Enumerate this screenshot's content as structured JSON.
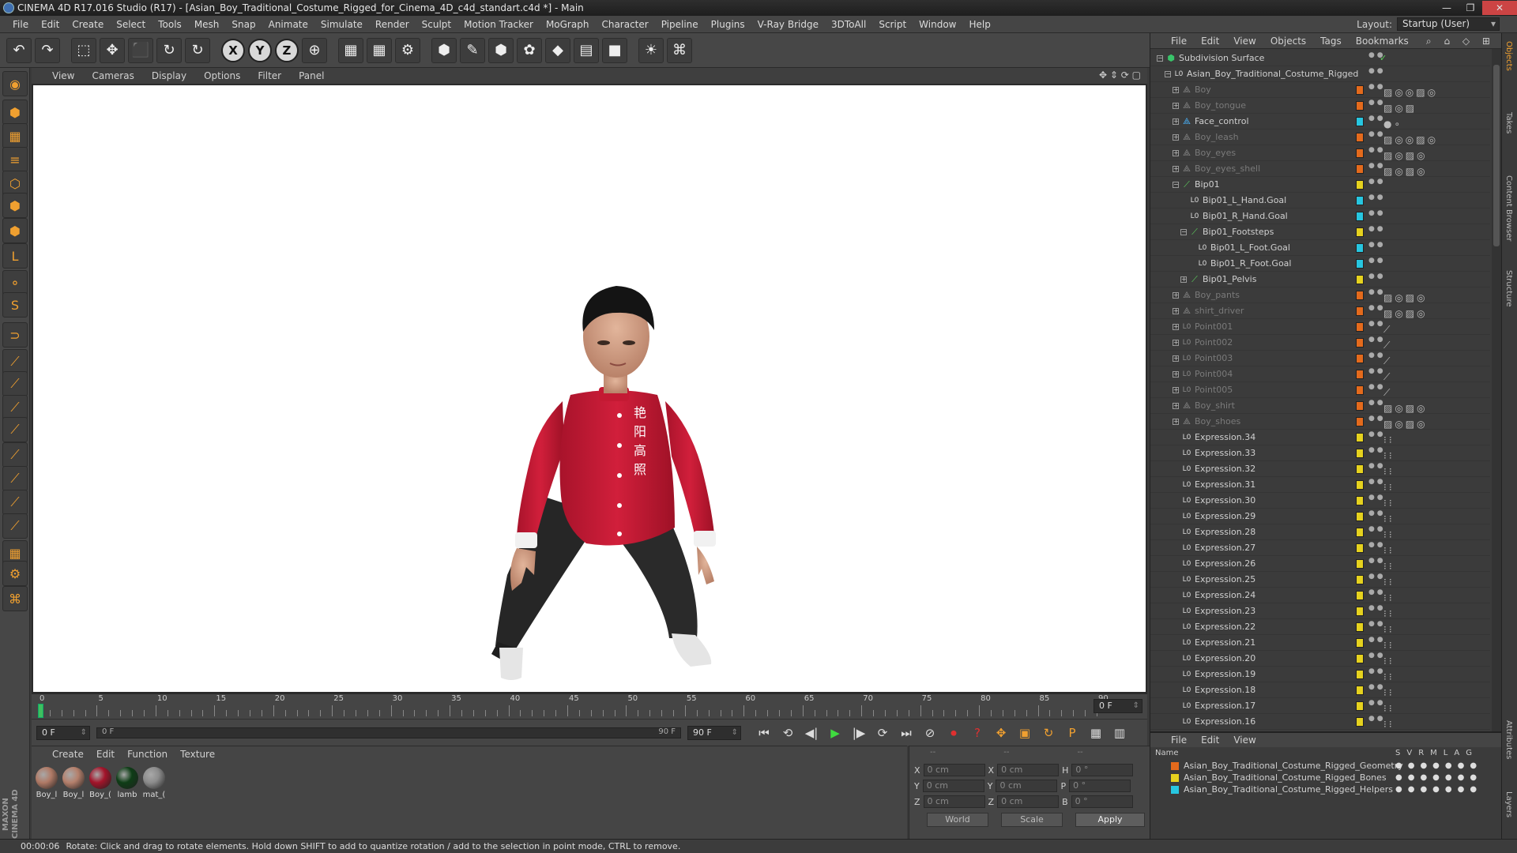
{
  "window": {
    "title": "CINEMA 4D R17.016 Studio (R17) - [Asian_Boy_Traditional_Costume_Rigged_for_Cinema_4D_c4d_standart.c4d *] - Main",
    "min": "—",
    "max": "❐",
    "close": "✕"
  },
  "menu": [
    "File",
    "Edit",
    "Create",
    "Select",
    "Tools",
    "Mesh",
    "Snap",
    "Animate",
    "Simulate",
    "Render",
    "Sculpt",
    "Motion Tracker",
    "MoGraph",
    "Character",
    "Pipeline",
    "Plugins",
    "V-Ray Bridge",
    "3DToAll",
    "Script",
    "Window",
    "Help"
  ],
  "layout": {
    "label": "Layout:",
    "value": "Startup (User)"
  },
  "toolbar": {
    "icons": [
      "undo-icon",
      "redo-icon",
      "live-selection-icon",
      "move-icon",
      "scale-icon",
      "rotate-icon",
      "recent-tool-icon",
      "x-axis-icon",
      "y-axis-icon",
      "z-axis-icon",
      "world-coordinates-icon",
      "render-view-icon",
      "render-picture-viewer-icon",
      "edit-render-settings-icon",
      "cube-icon",
      "pen-spline-icon",
      "subdivision-surface-icon",
      "cloner-icon",
      "deformer-icon",
      "floor-icon",
      "camera-icon",
      "light-icon",
      "python-icon"
    ],
    "glyphs": [
      "↶",
      "↷",
      "⬚",
      "✥",
      "⬛",
      "↻",
      "↻",
      "X",
      "Y",
      "Z",
      "⊕",
      "▦",
      "▦",
      "⚙",
      "⬢",
      "✎",
      "⬢",
      "✿",
      "◆",
      "▤",
      "■",
      "☀",
      "⌘"
    ]
  },
  "viewport": {
    "menu": [
      "View",
      "Cameras",
      "Display",
      "Options",
      "Filter",
      "Panel"
    ],
    "nav": "✥ ⇕ ⟳ ▢"
  },
  "timeline": {
    "ticks": [
      "0",
      "5",
      "10",
      "15",
      "20",
      "25",
      "30",
      "35",
      "40",
      "45",
      "50",
      "55",
      "60",
      "65",
      "70",
      "75",
      "80",
      "85",
      "90"
    ],
    "current_frame": "0 F",
    "start_field": "0 F",
    "range_start": "0 F",
    "range_end": "90 F",
    "end_field": "90 F"
  },
  "transport": {
    "glyphs": [
      "⏮",
      "⟲",
      "◀|",
      "▶",
      "|▶",
      "⟳",
      "⏭",
      "⊘",
      "⏺",
      "?",
      "✥",
      "▣",
      "↻",
      "P",
      "▦",
      "▥"
    ]
  },
  "materials": {
    "menu": [
      "Create",
      "Edit",
      "Function",
      "Texture"
    ],
    "items": [
      {
        "label": "Boy_l",
        "color": "#b07a66"
      },
      {
        "label": "Boy_l",
        "color": "#b5806c"
      },
      {
        "label": "Boy_(",
        "color": "#a3142a"
      },
      {
        "label": "lamb",
        "color": "#0e3d16"
      },
      {
        "label": "mat_(",
        "color": "#8c8c8c"
      }
    ]
  },
  "coords": {
    "headers": [
      "--",
      "--",
      "--"
    ],
    "rows": [
      {
        "a": "X",
        "av": "0 cm",
        "b": "X",
        "bv": "0 cm",
        "c": "H",
        "cv": "0 °"
      },
      {
        "a": "Y",
        "av": "0 cm",
        "b": "Y",
        "bv": "0 cm",
        "c": "P",
        "cv": "0 °"
      },
      {
        "a": "Z",
        "av": "0 cm",
        "b": "Z",
        "bv": "0 cm",
        "c": "B",
        "cv": "0 °"
      }
    ],
    "mode": "World",
    "type": "Scale",
    "apply": "Apply"
  },
  "status": {
    "time": "00:00:06",
    "message": "Rotate: Click and drag to rotate elements. Hold down SHIFT to add to quantize rotation / add to the selection in point mode, CTRL to remove."
  },
  "objects": {
    "menu": [
      "File",
      "Edit",
      "View",
      "Objects",
      "Tags",
      "Bookmarks"
    ],
    "toolicons": "⌕ ⌂ ◇ ⊞",
    "items": [
      {
        "name": "Subdivision Surface",
        "depth": 0,
        "tog": "−",
        "icon": "⬢",
        "iconc": "#39c46a",
        "layer": "",
        "dim": false,
        "check": true
      },
      {
        "name": "Asian_Boy_Traditional_Costume_Rigged",
        "depth": 1,
        "tog": "−",
        "icon": "L0",
        "iconc": "#ddd",
        "layer": "",
        "dim": false
      },
      {
        "name": "Boy",
        "depth": 2,
        "tog": "+",
        "icon": "⟁",
        "iconc": "#888",
        "layer": "#e46a1c",
        "dim": true,
        "tags": "▨◎◎▨◎"
      },
      {
        "name": "Boy_tongue",
        "depth": 2,
        "tog": "+",
        "icon": "⟁",
        "iconc": "#888",
        "layer": "#e46a1c",
        "dim": true,
        "tags": "▨◎▨"
      },
      {
        "name": "Face_control",
        "depth": 2,
        "tog": "+",
        "icon": "⟁",
        "iconc": "#4ab5ff",
        "layer": "#27c6e0",
        "dim": false,
        "tags": "●∘"
      },
      {
        "name": "Boy_leash",
        "depth": 2,
        "tog": "+",
        "icon": "⟁",
        "iconc": "#888",
        "layer": "#e46a1c",
        "dim": true,
        "tags": "▨◎◎▨◎"
      },
      {
        "name": "Boy_eyes",
        "depth": 2,
        "tog": "+",
        "icon": "⟁",
        "iconc": "#888",
        "layer": "#e46a1c",
        "dim": true,
        "tags": "▨◎▨◎"
      },
      {
        "name": "Boy_eyes_shell",
        "depth": 2,
        "tog": "+",
        "icon": "⟁",
        "iconc": "#888",
        "layer": "#e46a1c",
        "dim": true,
        "tags": "▨◎▨◎"
      },
      {
        "name": "Bip01",
        "depth": 2,
        "tog": "−",
        "icon": "⟋",
        "iconc": "#5fd35f",
        "layer": "#e6d21e",
        "dim": false
      },
      {
        "name": "Bip01_L_Hand.Goal",
        "depth": 3,
        "tog": "",
        "icon": "L0",
        "iconc": "#ddd",
        "layer": "#27c6e0",
        "dim": false
      },
      {
        "name": "Bip01_R_Hand.Goal",
        "depth": 3,
        "tog": "",
        "icon": "L0",
        "iconc": "#ddd",
        "layer": "#27c6e0",
        "dim": false
      },
      {
        "name": "Bip01_Footsteps",
        "depth": 3,
        "tog": "−",
        "icon": "⟋",
        "iconc": "#5fd35f",
        "layer": "#e6d21e",
        "dim": false
      },
      {
        "name": "Bip01_L_Foot.Goal",
        "depth": 4,
        "tog": "",
        "icon": "L0",
        "iconc": "#ddd",
        "layer": "#27c6e0",
        "dim": false
      },
      {
        "name": "Bip01_R_Foot.Goal",
        "depth": 4,
        "tog": "",
        "icon": "L0",
        "iconc": "#ddd",
        "layer": "#27c6e0",
        "dim": false
      },
      {
        "name": "Bip01_Pelvis",
        "depth": 3,
        "tog": "+",
        "icon": "⟋",
        "iconc": "#5fd35f",
        "layer": "#e6d21e",
        "dim": false
      },
      {
        "name": "Boy_pants",
        "depth": 2,
        "tog": "+",
        "icon": "⟁",
        "iconc": "#888",
        "layer": "#e46a1c",
        "dim": true,
        "tags": "▨◎▨◎"
      },
      {
        "name": "shirt_driver",
        "depth": 2,
        "tog": "+",
        "icon": "⟁",
        "iconc": "#888",
        "layer": "#e46a1c",
        "dim": true,
        "tags": "▨◎▨◎"
      },
      {
        "name": "Point001",
        "depth": 2,
        "tog": "+",
        "icon": "L0",
        "iconc": "#888",
        "layer": "#e46a1c",
        "dim": true,
        "tags": "⟋"
      },
      {
        "name": "Point002",
        "depth": 2,
        "tog": "+",
        "icon": "L0",
        "iconc": "#888",
        "layer": "#e46a1c",
        "dim": true,
        "tags": "⟋"
      },
      {
        "name": "Point003",
        "depth": 2,
        "tog": "+",
        "icon": "L0",
        "iconc": "#888",
        "layer": "#e46a1c",
        "dim": true,
        "tags": "⟋"
      },
      {
        "name": "Point004",
        "depth": 2,
        "tog": "+",
        "icon": "L0",
        "iconc": "#888",
        "layer": "#e46a1c",
        "dim": true,
        "tags": "⟋"
      },
      {
        "name": "Point005",
        "depth": 2,
        "tog": "+",
        "icon": "L0",
        "iconc": "#888",
        "layer": "#e46a1c",
        "dim": true,
        "tags": "⟋"
      },
      {
        "name": "Boy_shirt",
        "depth": 2,
        "tog": "+",
        "icon": "⟁",
        "iconc": "#888",
        "layer": "#e46a1c",
        "dim": true,
        "tags": "▨◎▨◎"
      },
      {
        "name": "Boy_shoes",
        "depth": 2,
        "tog": "+",
        "icon": "⟁",
        "iconc": "#888",
        "layer": "#e46a1c",
        "dim": true,
        "tags": "▨◎▨◎"
      },
      {
        "name": "Expression.34",
        "depth": 2,
        "tog": "",
        "icon": "L0",
        "iconc": "#ddd",
        "layer": "#e6d21e",
        "dim": false,
        "tags": "⁝⁝"
      },
      {
        "name": "Expression.33",
        "depth": 2,
        "tog": "",
        "icon": "L0",
        "iconc": "#ddd",
        "layer": "#e6d21e",
        "dim": false,
        "tags": "⁝⁝"
      },
      {
        "name": "Expression.32",
        "depth": 2,
        "tog": "",
        "icon": "L0",
        "iconc": "#ddd",
        "layer": "#e6d21e",
        "dim": false,
        "tags": "⁝⁝"
      },
      {
        "name": "Expression.31",
        "depth": 2,
        "tog": "",
        "icon": "L0",
        "iconc": "#ddd",
        "layer": "#e6d21e",
        "dim": false,
        "tags": "⁝⁝"
      },
      {
        "name": "Expression.30",
        "depth": 2,
        "tog": "",
        "icon": "L0",
        "iconc": "#ddd",
        "layer": "#e6d21e",
        "dim": false,
        "tags": "⁝⁝"
      },
      {
        "name": "Expression.29",
        "depth": 2,
        "tog": "",
        "icon": "L0",
        "iconc": "#ddd",
        "layer": "#e6d21e",
        "dim": false,
        "tags": "⁝⁝"
      },
      {
        "name": "Expression.28",
        "depth": 2,
        "tog": "",
        "icon": "L0",
        "iconc": "#ddd",
        "layer": "#e6d21e",
        "dim": false,
        "tags": "⁝⁝"
      },
      {
        "name": "Expression.27",
        "depth": 2,
        "tog": "",
        "icon": "L0",
        "iconc": "#ddd",
        "layer": "#e6d21e",
        "dim": false,
        "tags": "⁝⁝"
      },
      {
        "name": "Expression.26",
        "depth": 2,
        "tog": "",
        "icon": "L0",
        "iconc": "#ddd",
        "layer": "#e6d21e",
        "dim": false,
        "tags": "⁝⁝"
      },
      {
        "name": "Expression.25",
        "depth": 2,
        "tog": "",
        "icon": "L0",
        "iconc": "#ddd",
        "layer": "#e6d21e",
        "dim": false,
        "tags": "⁝⁝"
      },
      {
        "name": "Expression.24",
        "depth": 2,
        "tog": "",
        "icon": "L0",
        "iconc": "#ddd",
        "layer": "#e6d21e",
        "dim": false,
        "tags": "⁝⁝"
      },
      {
        "name": "Expression.23",
        "depth": 2,
        "tog": "",
        "icon": "L0",
        "iconc": "#ddd",
        "layer": "#e6d21e",
        "dim": false,
        "tags": "⁝⁝"
      },
      {
        "name": "Expression.22",
        "depth": 2,
        "tog": "",
        "icon": "L0",
        "iconc": "#ddd",
        "layer": "#e6d21e",
        "dim": false,
        "tags": "⁝⁝"
      },
      {
        "name": "Expression.21",
        "depth": 2,
        "tog": "",
        "icon": "L0",
        "iconc": "#ddd",
        "layer": "#e6d21e",
        "dim": false,
        "tags": "⁝⁝"
      },
      {
        "name": "Expression.20",
        "depth": 2,
        "tog": "",
        "icon": "L0",
        "iconc": "#ddd",
        "layer": "#e6d21e",
        "dim": false,
        "tags": "⁝⁝"
      },
      {
        "name": "Expression.19",
        "depth": 2,
        "tog": "",
        "icon": "L0",
        "iconc": "#ddd",
        "layer": "#e6d21e",
        "dim": false,
        "tags": "⁝⁝"
      },
      {
        "name": "Expression.18",
        "depth": 2,
        "tog": "",
        "icon": "L0",
        "iconc": "#ddd",
        "layer": "#e6d21e",
        "dim": false,
        "tags": "⁝⁝"
      },
      {
        "name": "Expression.17",
        "depth": 2,
        "tog": "",
        "icon": "L0",
        "iconc": "#ddd",
        "layer": "#e6d21e",
        "dim": false,
        "tags": "⁝⁝"
      },
      {
        "name": "Expression.16",
        "depth": 2,
        "tog": "",
        "icon": "L0",
        "iconc": "#ddd",
        "layer": "#e6d21e",
        "dim": false,
        "tags": "⁝⁝"
      }
    ]
  },
  "layers": {
    "menu": [
      "File",
      "Edit",
      "View"
    ],
    "header": {
      "name": "Name",
      "flags": [
        "S",
        "V",
        "R",
        "M",
        "L",
        "A",
        "G"
      ]
    },
    "items": [
      {
        "name": "Asian_Boy_Traditional_Costume_Rigged_Geometry",
        "color": "#e46a1c"
      },
      {
        "name": "Asian_Boy_Traditional_Costume_Rigged_Bones",
        "color": "#e6d21e"
      },
      {
        "name": "Asian_Boy_Traditional_Costume_Rigged_Helpers",
        "color": "#27c6e0"
      }
    ]
  },
  "sidetabs": [
    "Objects",
    "Takes",
    "Content Browser",
    "Structure",
    "Attributes",
    "Layers"
  ],
  "shirt_text": [
    "艳",
    "阳",
    "高",
    "照"
  ]
}
